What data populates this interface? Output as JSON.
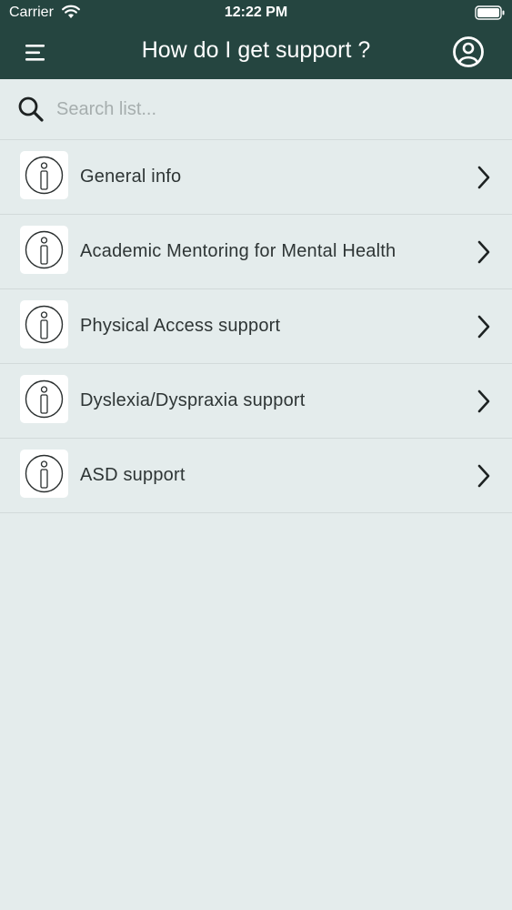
{
  "status_bar": {
    "carrier": "Carrier",
    "time": "12:22 PM"
  },
  "nav": {
    "title": "How do I get support ?",
    "menu_icon": "hamburger-menu-icon",
    "profile_icon": "user-profile-icon"
  },
  "search": {
    "placeholder": "Search list...",
    "value": ""
  },
  "list": {
    "items": [
      {
        "label": "General info",
        "icon": "info-icon"
      },
      {
        "label": "Academic Mentoring for Mental Health",
        "icon": "info-icon"
      },
      {
        "label": "Physical Access support",
        "icon": "info-icon"
      },
      {
        "label": "Dyslexia/Dyspraxia support",
        "icon": "info-icon"
      },
      {
        "label": "ASD support",
        "icon": "info-icon"
      }
    ]
  },
  "colors": {
    "header_bg": "#254540",
    "page_bg": "#e4ecec",
    "text": "#2e3535",
    "divider": "#d2dada"
  }
}
